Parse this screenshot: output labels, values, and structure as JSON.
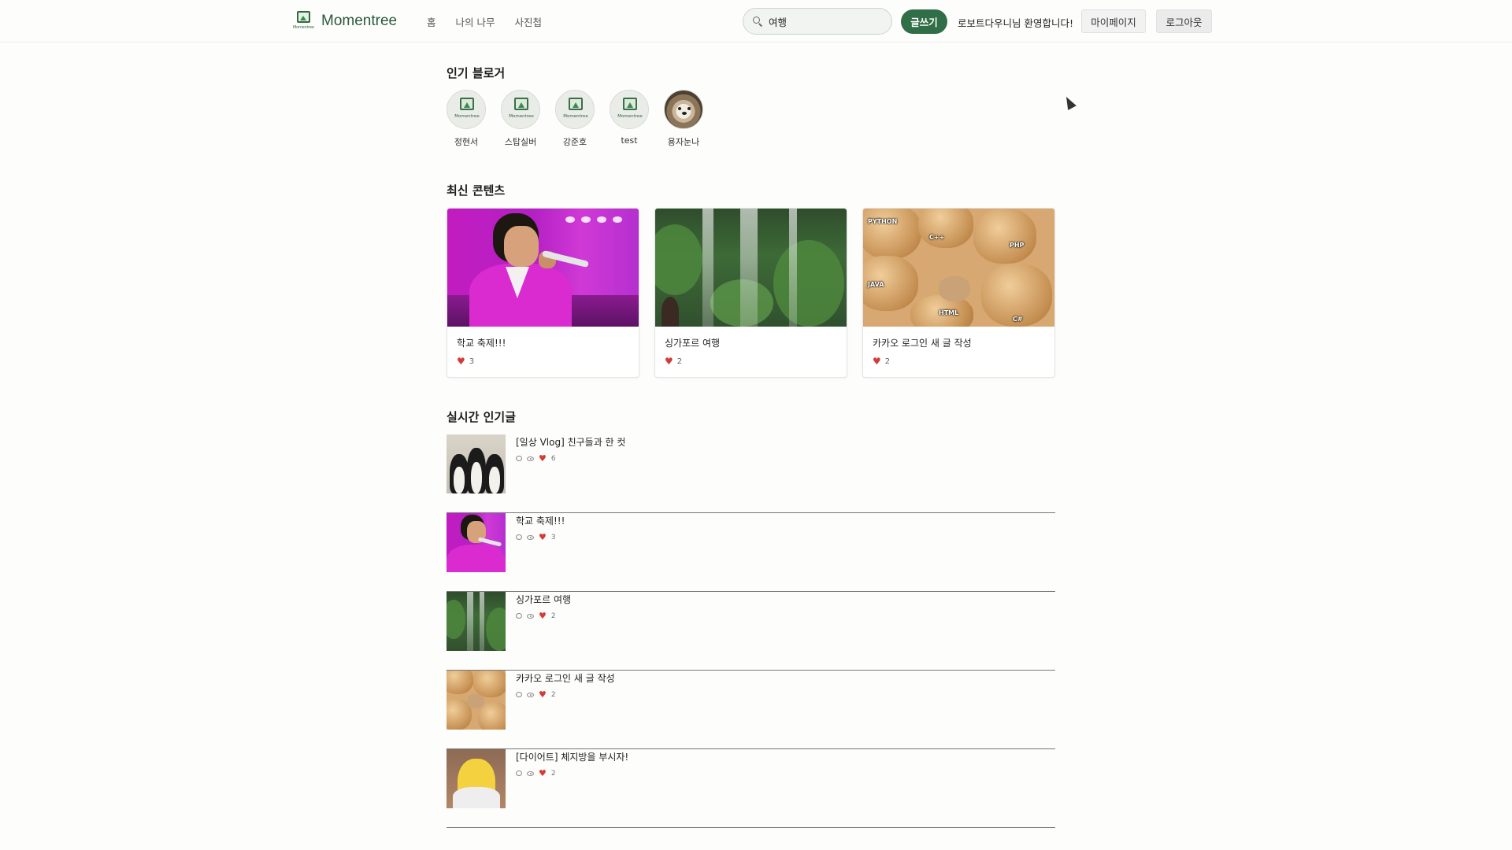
{
  "header": {
    "logo_tiny": "Momentree",
    "logo_text": "Momentree",
    "nav": [
      "홈",
      "나의 나무",
      "사진첩"
    ],
    "search_value": "여행",
    "write_label": "글쓰기",
    "welcome": "로보트다우니님 환영합니다!",
    "mypage_label": "마이페이지",
    "logout_label": "로그아웃"
  },
  "popular_bloggers": {
    "title": "인기 블로거",
    "avatar_tiny": "Momentree",
    "items": [
      {
        "name": "정현서",
        "avatar": "momentree-default-icon"
      },
      {
        "name": "스탑실버",
        "avatar": "momentree-default-icon"
      },
      {
        "name": "강준호",
        "avatar": "momentree-default-icon"
      },
      {
        "name": "test",
        "avatar": "momentree-default-icon"
      },
      {
        "name": "용자눈나",
        "avatar": "dog-photo"
      }
    ]
  },
  "latest": {
    "title": "최신 콘텐츠",
    "cards": [
      {
        "title": "학교 축제!!!",
        "likes": "3",
        "image": "concert-singer-photo"
      },
      {
        "title": "싱가포르 여행",
        "likes": "2",
        "image": "indoor-waterfall-garden-photo"
      },
      {
        "title": "카카오 로그인 새 글 작성",
        "likes": "2",
        "image": "bread-cat-meme"
      }
    ],
    "bread_labels": [
      "PYTHON",
      "C++",
      "PHP",
      "JAVA",
      "HTML",
      "C#"
    ]
  },
  "realtime": {
    "title": "실시간 인기글",
    "items": [
      {
        "title": "[일상 Vlog] 친구들과 한 컷",
        "likes": "6",
        "image": "penguins-photo"
      },
      {
        "title": "학교 축제!!!",
        "likes": "3",
        "image": "concert-singer-photo"
      },
      {
        "title": "싱가포르 여행",
        "likes": "2",
        "image": "indoor-waterfall-garden-photo"
      },
      {
        "title": "카카오 로그인 새 글 작성",
        "likes": "2",
        "image": "bread-cat-meme"
      },
      {
        "title": "[다이어트] 체지방을 부시자!",
        "likes": "2",
        "image": "homer-cartoon"
      }
    ]
  },
  "colors": {
    "brand_green": "#2f6e46",
    "heart_red": "#d33a3a",
    "background": "#fdfdfc"
  }
}
